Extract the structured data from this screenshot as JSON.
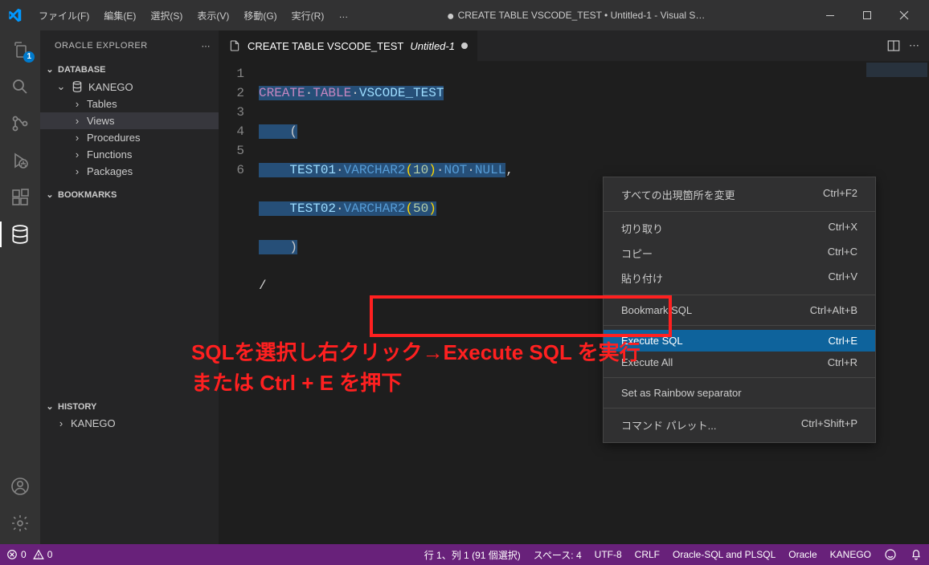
{
  "menubar": {
    "items": [
      "ファイル(F)",
      "編集(E)",
      "選択(S)",
      "表示(V)",
      "移動(G)",
      "実行(R)"
    ],
    "overflow": "…"
  },
  "window": {
    "title": "CREATE TABLE VSCODE_TEST • Untitled-1 - Visual S…",
    "dirty_indicator": "●"
  },
  "activitybar": {
    "explorer_badge": "1"
  },
  "sidebar": {
    "title": "ORACLE EXPLORER",
    "overflow": "⋯",
    "sections": {
      "database": {
        "label": "DATABASE"
      },
      "bookmarks": {
        "label": "BOOKMARKS"
      },
      "history": {
        "label": "HISTORY"
      }
    },
    "connection": {
      "name": "KANEGO",
      "children": [
        "Tables",
        "Views",
        "Procedures",
        "Functions",
        "Packages"
      ]
    },
    "history_items": [
      "KANEGO"
    ]
  },
  "tab": {
    "label": "CREATE TABLE VSCODE_TEST",
    "filename": "Untitled-1"
  },
  "code": {
    "line_numbers": [
      "1",
      "2",
      "3",
      "4",
      "5",
      "6"
    ],
    "l1": {
      "a": "CREATE",
      "b": "TABLE",
      "c": "VSCODE_TEST"
    },
    "l2": "    (",
    "l3": {
      "a": "TEST01",
      "b": "VARCHAR2",
      "c": "(",
      "d": "10",
      "e": ")",
      "f": "NOT",
      "g": "NULL",
      "h": ","
    },
    "l4": {
      "a": "TEST02",
      "b": "VARCHAR2",
      "c": "(",
      "d": "50",
      "e": ")"
    },
    "l5": "    )",
    "l6": "/"
  },
  "context_menu": {
    "items": [
      {
        "label": "すべての出現箇所を変更",
        "kbd": "Ctrl+F2"
      },
      {
        "sep": true
      },
      {
        "label": "切り取り",
        "kbd": "Ctrl+X"
      },
      {
        "label": "コピー",
        "kbd": "Ctrl+C"
      },
      {
        "label": "貼り付け",
        "kbd": "Ctrl+V"
      },
      {
        "sep": true
      },
      {
        "label": "Bookmark SQL",
        "kbd": "Ctrl+Alt+B"
      },
      {
        "sep": true
      },
      {
        "label": "Execute SQL",
        "kbd": "Ctrl+E",
        "hl": true
      },
      {
        "label": "Execute All",
        "kbd": "Ctrl+R"
      },
      {
        "sep": true
      },
      {
        "label": "Set as Rainbow separator",
        "kbd": ""
      },
      {
        "sep": true
      },
      {
        "label": "コマンド パレット...",
        "kbd": "Ctrl+Shift+P"
      }
    ]
  },
  "annotation": {
    "line1": "SQLを選択し右クリック→Execute SQL を実行",
    "line2": "または Ctrl + E を押下"
  },
  "statusbar": {
    "errors": "0",
    "warnings": "0",
    "cursor": "行 1、列 1 (91 個選択)",
    "spaces": "スペース: 4",
    "encoding": "UTF-8",
    "eol": "CRLF",
    "language": "Oracle-SQL and PLSQL",
    "group": "Oracle",
    "connection": "KANEGO"
  }
}
